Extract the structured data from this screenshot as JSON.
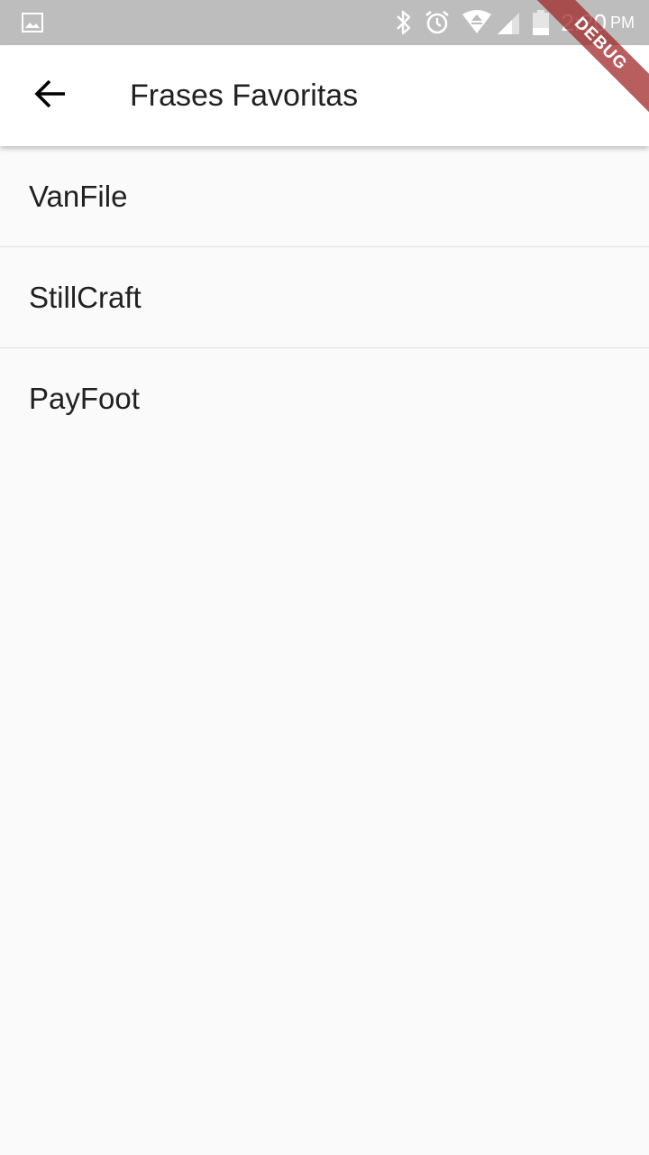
{
  "status_bar": {
    "time": "2:20",
    "ampm": "PM",
    "icons": [
      "gallery-icon",
      "bluetooth-icon",
      "alarm-icon",
      "wifi-icon",
      "signal-icon",
      "battery-icon"
    ],
    "background": "#bdbdbd"
  },
  "app_bar": {
    "back_icon": "arrow-back-icon",
    "title": "Frases Favoritas",
    "background": "#ffffff"
  },
  "list": {
    "items": [
      {
        "label": "VanFile"
      },
      {
        "label": "StillCraft"
      },
      {
        "label": "PayFoot"
      }
    ]
  },
  "debug_banner": {
    "label": "DEBUG",
    "color": "#a02828"
  }
}
